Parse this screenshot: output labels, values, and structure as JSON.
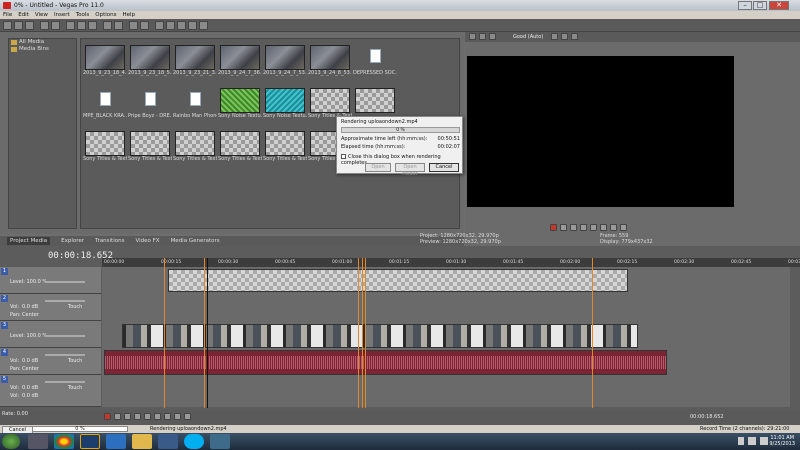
{
  "window": {
    "title": "0% - Untitled - Vegas Pro 11.0"
  },
  "menu": [
    "File",
    "Edit",
    "View",
    "Insert",
    "Tools",
    "Options",
    "Help"
  ],
  "explorer": {
    "tree_items": [
      "All Media",
      "Media Bins"
    ],
    "media": [
      {
        "label": "2013_9_23_18_4...",
        "kind": "video"
      },
      {
        "label": "2013_9_23_18_5...",
        "kind": "video"
      },
      {
        "label": "2013_9_23_21_3...",
        "kind": "video"
      },
      {
        "label": "2013_9_24_7_36...",
        "kind": "video"
      },
      {
        "label": "2013_9_24_7_53...",
        "kind": "video"
      },
      {
        "label": "2013_9_24_8_53...",
        "kind": "video"
      },
      {
        "label": "DEPRESSED SOC...",
        "kind": "doc"
      },
      {
        "label": "MPE_BLACK KRA...",
        "kind": "doc"
      },
      {
        "label": "Pripe Boyz - DRE...",
        "kind": "doc"
      },
      {
        "label": "Rainbo Man Phone...",
        "kind": "doc"
      },
      {
        "label": "Sony Noise Textu...",
        "kind": "green"
      },
      {
        "label": "Sony Noise Textu...",
        "kind": "cyan"
      },
      {
        "label": "Sony Titles & Text 1",
        "kind": "checker"
      },
      {
        "label": "",
        "kind": "checker"
      },
      {
        "label": "Sony Titles & Text 2",
        "kind": "checker"
      },
      {
        "label": "Sony Titles & Text 3",
        "kind": "checker"
      },
      {
        "label": "Sony Titles & Text 4",
        "kind": "checker"
      },
      {
        "label": "Sony Titles & Text 6",
        "kind": "checker"
      },
      {
        "label": "Sony Titles & Text 7",
        "kind": "checker"
      },
      {
        "label": "Sony Titles & Text 8",
        "kind": "checker"
      },
      {
        "label": "Sony Titles & Tex...",
        "kind": "checker"
      }
    ],
    "tabs": [
      "Project Media",
      "Explorer",
      "Transitions",
      "Video FX",
      "Media Generators"
    ]
  },
  "preview": {
    "quality": "Good (Auto)",
    "project_label": "Project:",
    "project_value": "1280x720x32, 29.970p",
    "preview_label": "Preview:",
    "preview_value": "1280x720x32, 29.970p",
    "frame_label": "Frame:",
    "frame_value": "559",
    "display_label": "Display:",
    "display_value": "779x437x32"
  },
  "dialog": {
    "title": "Rendering uploaondown2.mp4",
    "percent": "0 %",
    "progress": 0.0,
    "time_left_label": "Approximate time left (hh:mm:ss):",
    "time_left_value": "00:50:51",
    "elapsed_label": "Elapsed time (hh:mm:ss):",
    "elapsed_value": "00:02:07",
    "close_checkbox": "Close this dialog box when rendering completes",
    "open_button": "Open",
    "open_folder_button": "Open Folder",
    "cancel_button": "Cancel"
  },
  "timeline": {
    "timecode": "00:00:18.652",
    "ruler_ticks": [
      "00:00:00",
      "00:00:15",
      "00:00:30",
      "00:00:45",
      "00:01:00",
      "00:01:15",
      "00:01:30",
      "00:01:45",
      "00:02:00",
      "00:02:15",
      "00:02:30",
      "00:02:45",
      "00:03:00"
    ],
    "tracks": [
      {
        "num": "1",
        "level": "Level: 100.0 %"
      },
      {
        "num": "2",
        "vol": "Vol:",
        "vol_value": "0.0 dB",
        "pan": "Pan:",
        "pan_value": "Center",
        "mode": "Touch"
      },
      {
        "num": "3",
        "level": "Level: 100.0 %"
      },
      {
        "num": "4",
        "vol": "Vol:",
        "vol_value": "0.0 dB",
        "pan": "Pan:",
        "pan_value": "Center",
        "mode": "Touch"
      },
      {
        "num": "5",
        "vol": "Vol:",
        "vol_value": "0.0 dB",
        "pan": "Vol:",
        "pan_value": "0.0 dB",
        "mode": "Touch"
      }
    ],
    "rate": "Rate: 0.00",
    "end_time": "00:00:18.652"
  },
  "status": {
    "cancel": "Cancel",
    "percent": "0 %",
    "render_text": "Rendering uploaondown2.mp4",
    "record_time": "Record Time (2 channels): 29:21:00"
  },
  "taskbar": {
    "time": "11:01 AM",
    "date": "9/25/2013"
  }
}
